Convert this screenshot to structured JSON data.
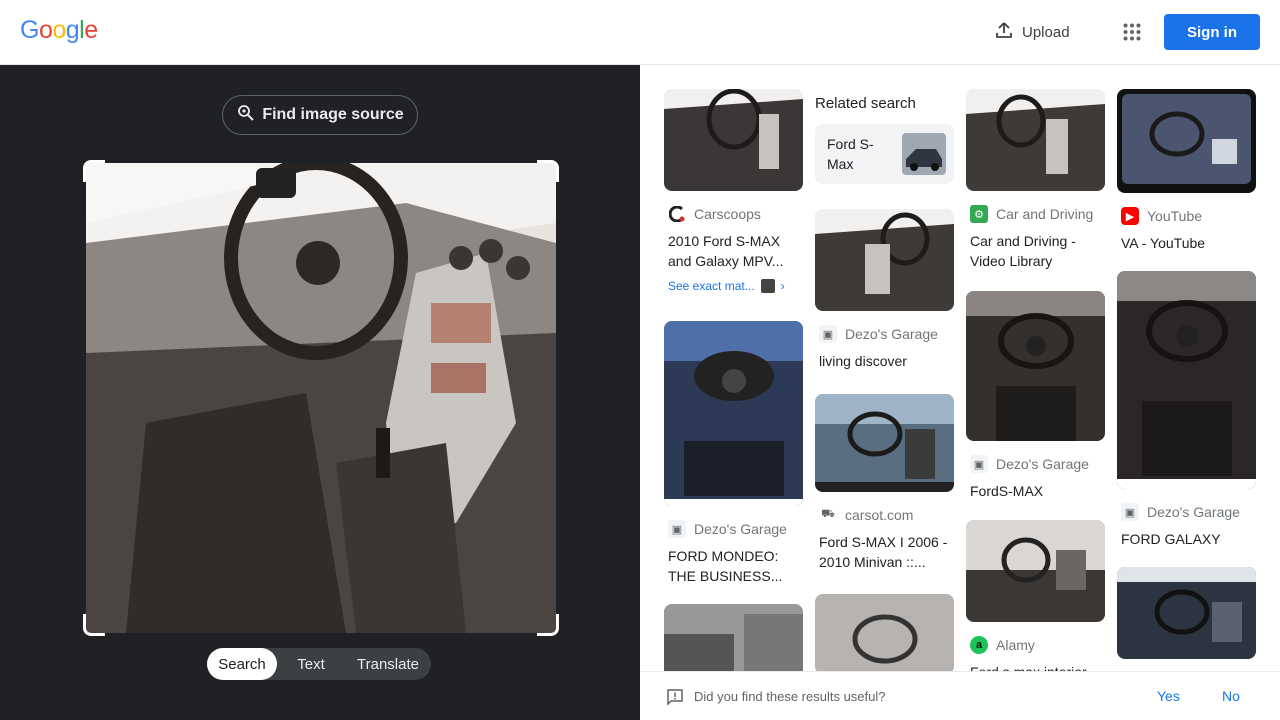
{
  "header": {
    "logo_letters": [
      "G",
      "o",
      "o",
      "g",
      "l",
      "e"
    ],
    "logo_colors": [
      "#4285f4",
      "#ea4335",
      "#fbbc05",
      "#4285f4",
      "#34a853",
      "#ea4335"
    ],
    "upload_label": "Upload",
    "signin_label": "Sign in"
  },
  "left": {
    "find_source_label": "Find image source",
    "tabs": [
      "Search",
      "Text",
      "Translate"
    ],
    "active_tab": "Search"
  },
  "related": {
    "title": "Related search",
    "chip_label": "Ford S-Max"
  },
  "results": [
    {
      "source": "Carscoops",
      "title": "2010 Ford S-MAX and Galaxy MPV...",
      "exact": "See exact mat..."
    },
    {
      "source": "Dezo's Garage",
      "title": "FORD MONDEO: THE BUSINESS..."
    },
    {
      "source": "Dezo's Garage",
      "title": "living discover"
    },
    {
      "source": "carsot.com",
      "title": "Ford S-MAX I 2006 - 2010 Minivan ::..."
    },
    {
      "source": "Car and Driving",
      "title": "Car and Driving - Video Library"
    },
    {
      "source": "Dezo's Garage",
      "title": "FordS-MAX"
    },
    {
      "source": "Alamy",
      "title": "Ford s max interior"
    },
    {
      "source": "YouTube",
      "title": "VA - YouTube"
    },
    {
      "source": "Dezo's Garage",
      "title": "FORD GALAXY"
    }
  ],
  "feedback": {
    "question": "Did you find these results useful?",
    "yes": "Yes",
    "no": "No"
  },
  "colors": {
    "accent": "#1a73e8",
    "dark_panel": "#202124"
  }
}
